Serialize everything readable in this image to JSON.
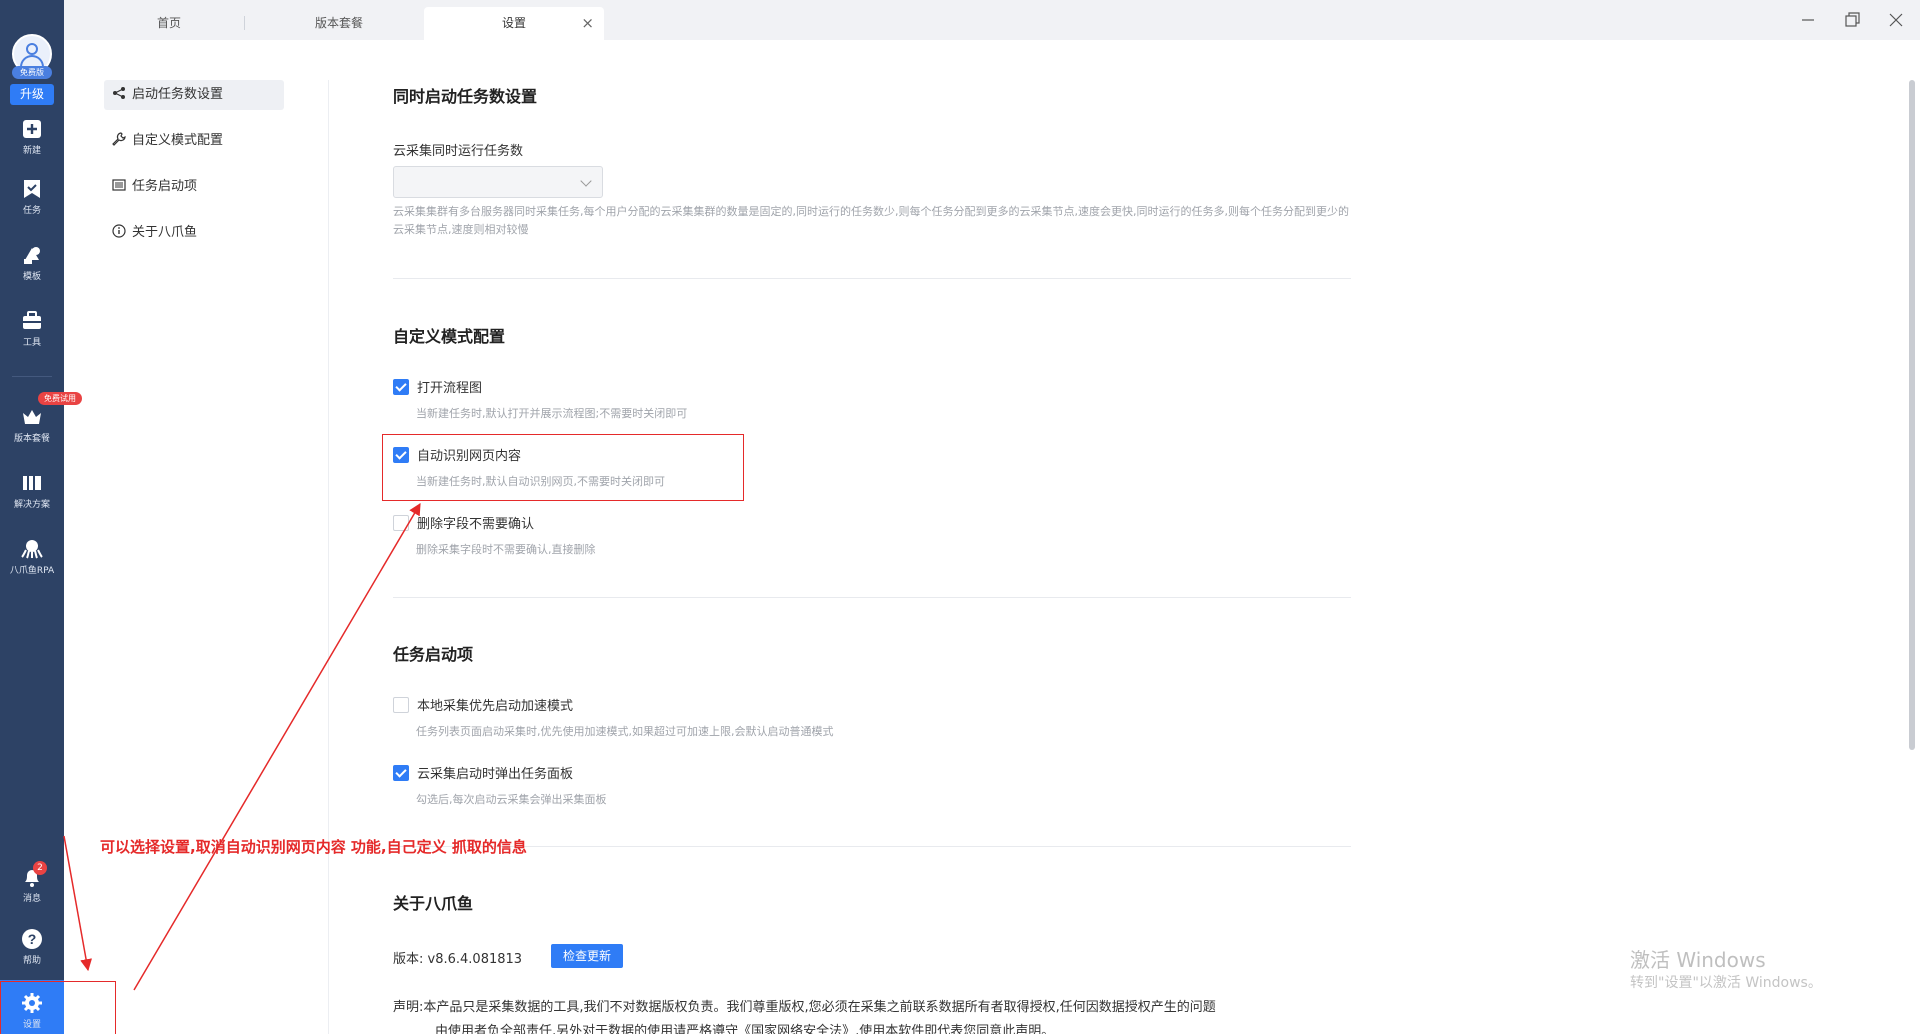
{
  "rail": {
    "avatar_tag": "免费版",
    "upgrade": "升级",
    "items": [
      {
        "label": "新建",
        "icon": "plus-square-icon"
      },
      {
        "label": "任务",
        "icon": "bookmark-icon"
      },
      {
        "label": "模板",
        "icon": "template-icon"
      },
      {
        "label": "工具",
        "icon": "toolbox-icon"
      },
      {
        "label": "版本套餐",
        "icon": "crown-icon"
      },
      {
        "label": "解决方案",
        "icon": "solution-icon"
      },
      {
        "label": "八爪鱼RPA",
        "icon": "octopus-icon"
      },
      {
        "label": "消息",
        "icon": "bell-icon"
      },
      {
        "label": "帮助",
        "icon": "help-icon"
      },
      {
        "label": "设置",
        "icon": "gear-icon"
      }
    ],
    "plans_badge": "免费试用",
    "message_count": "2"
  },
  "tabs": [
    {
      "label": "首页"
    },
    {
      "label": "版本套餐"
    },
    {
      "label": "设置",
      "close": "×"
    }
  ],
  "subnav": [
    {
      "label": "启动任务数设置",
      "icon": "share-icon"
    },
    {
      "label": "自定义模式配置",
      "icon": "wrench-icon"
    },
    {
      "label": "任务启动项",
      "icon": "list-icon"
    },
    {
      "label": "关于八爪鱼",
      "icon": "info-icon"
    }
  ],
  "concurrency": {
    "title": "同时启动任务数设置",
    "field_label": "云采集同时运行任务数",
    "hint": "云采集集群有多台服务器同时采集任务,每个用户分配的云采集集群的数量是固定的,同时运行的任务数少,则每个任务分配到更多的云采集节点,速度会更快,同时运行的任务多,则每个任务分配到更少的云采集节点,速度则相对较慢"
  },
  "custom_mode": {
    "title": "自定义模式配置",
    "options": [
      {
        "label": "打开流程图",
        "hint": "当新建任务时,默认打开并展示流程图;不需要时关闭即可",
        "checked": true
      },
      {
        "label": "自动识别网页内容",
        "hint": "当新建任务时,默认自动识别网页,不需要时关闭即可",
        "checked": true
      },
      {
        "label": "删除字段不需要确认",
        "hint": "删除采集字段时不需要确认,直接删除",
        "checked": false
      }
    ]
  },
  "startup": {
    "title": "任务启动项",
    "options": [
      {
        "label": "本地采集优先启动加速模式",
        "hint": "任务列表页面启动采集时,优先使用加速模式,如果超过可加速上限,会默认启动普通模式",
        "checked": false
      },
      {
        "label": "云采集启动时弹出任务面板",
        "hint": "勾选后,每次启动云采集会弹出采集面板",
        "checked": true
      }
    ]
  },
  "about": {
    "title": "关于八爪鱼",
    "version_label": "版本:",
    "version": "v8.6.4.081813",
    "check_update": "检查更新",
    "declaration_label": "声明:",
    "declaration_line1": "本产品只是采集数据的工具,我们不对数据版权负责。我们尊重版权,您必须在采集之前联系数据所有者取得授权,任何因数据授权产生的问题",
    "declaration_line2": "由使用者负全部责任,另外对于数据的使用请严格遵守《国家网络安全法》,使用本软件即代表您同意此声明。"
  },
  "watermark": {
    "line1": "激活 Windows",
    "line2": "转到\"设置\"以激活 Windows。"
  },
  "annotation": {
    "text": "可以选择设置,取消自动识别网页内容 功能,自己定义 抓取的信息",
    "color": "#e52a2a"
  },
  "colors": {
    "rail": "#2d4265",
    "accent": "#2f7cf6",
    "badge": "#e94343"
  }
}
